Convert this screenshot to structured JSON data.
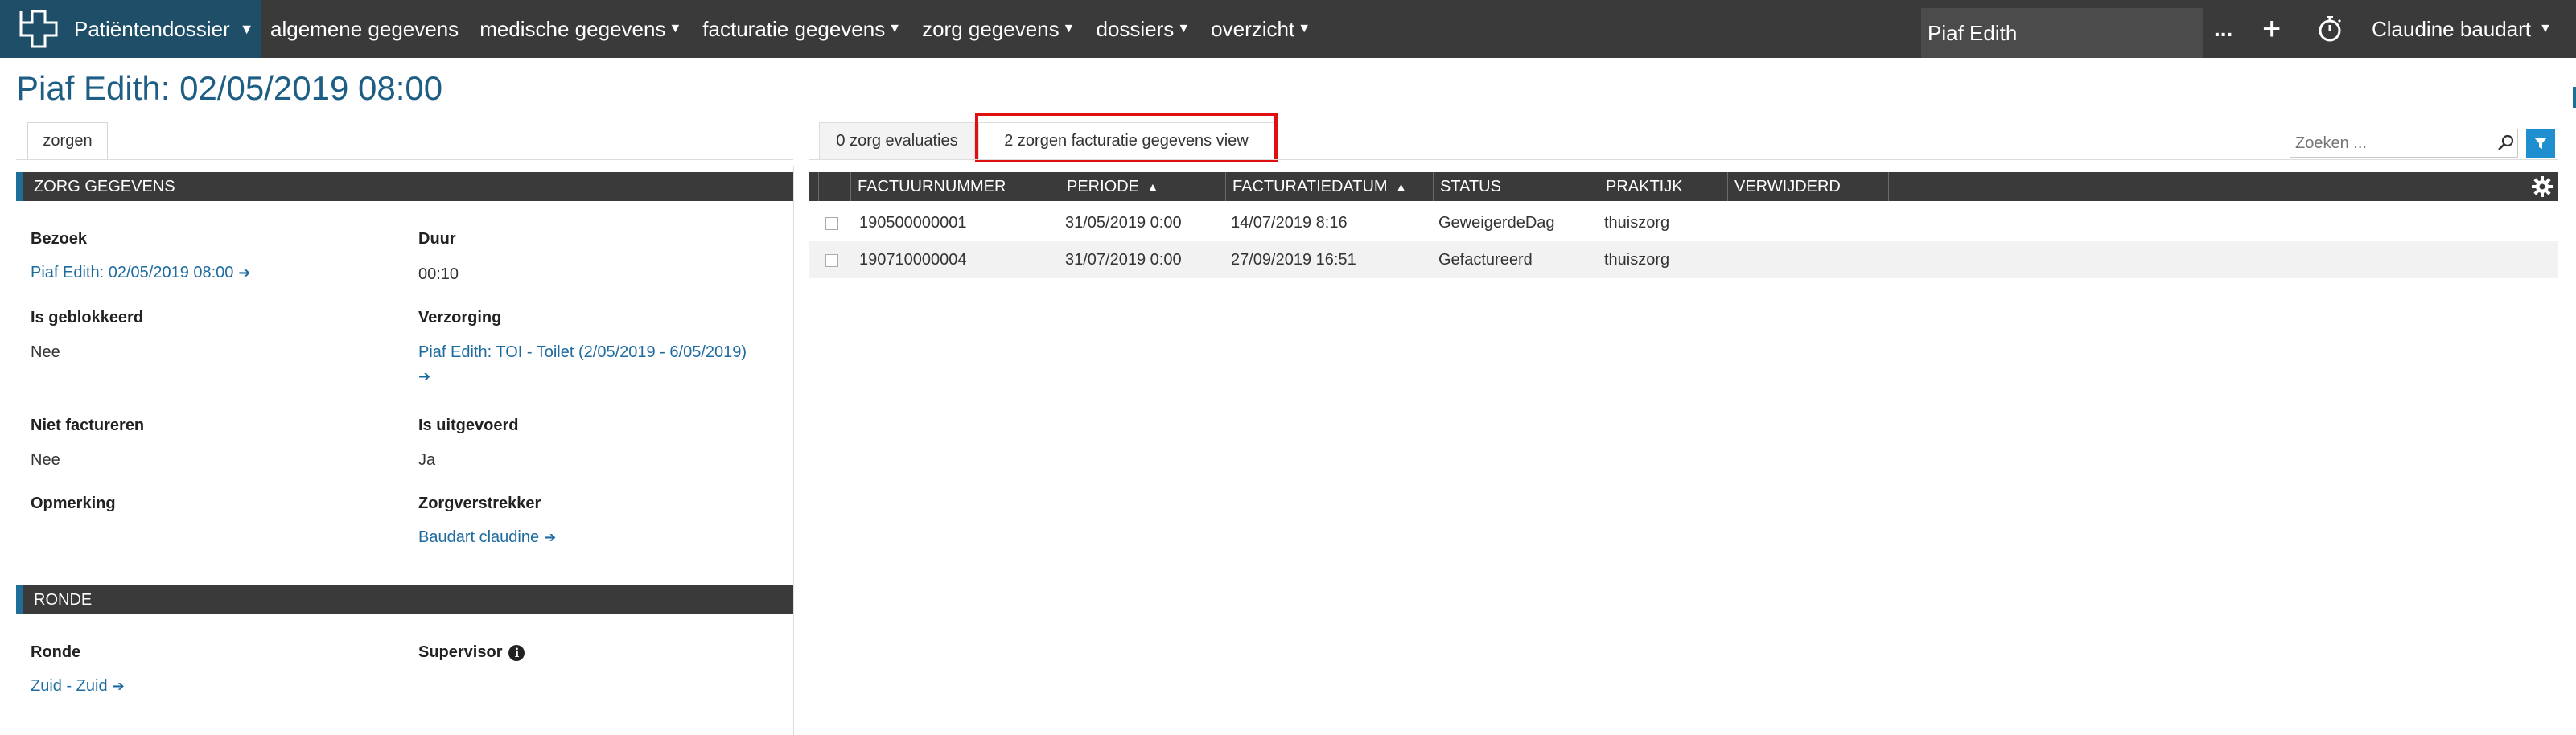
{
  "nav": {
    "brand_label": "Patiëntendossier",
    "menu": [
      {
        "label": "algemene gegevens",
        "dropdown": false
      },
      {
        "label": "medische gegevens",
        "dropdown": true
      },
      {
        "label": "facturatie gegevens",
        "dropdown": true
      },
      {
        "label": "zorg gegevens",
        "dropdown": true
      },
      {
        "label": "dossiers",
        "dropdown": true
      },
      {
        "label": "overzicht",
        "dropdown": true
      }
    ],
    "patient": "Piaf Edith",
    "more": "...",
    "user": "Claudine baudart",
    "icons": [
      "logo-cross-icon",
      "plus-icon",
      "stopwatch-icon"
    ]
  },
  "page_title": "Piaf Edith: 02/05/2019 08:00",
  "left": {
    "tab": "zorgen",
    "zorg_section": {
      "title": "ZORG GEGEVENS",
      "bezoek_label": "Bezoek",
      "bezoek_value": "Piaf Edith: 02/05/2019 08:00",
      "duur_label": "Duur",
      "duur_value": "00:10",
      "geblokkeerd_label": "Is geblokkeerd",
      "geblokkeerd_value": "Nee",
      "verzorging_label": "Verzorging",
      "verzorging_value": "Piaf Edith: TOI - Toilet (2/05/2019 - 6/05/2019)",
      "niet_factureren_label": "Niet factureren",
      "niet_factureren_value": "Nee",
      "uitgevoerd_label": "Is uitgevoerd",
      "uitgevoerd_value": "Ja",
      "opmerking_label": "Opmerking",
      "zorgverstrekker_label": "Zorgverstrekker",
      "zorgverstrekker_value": "Baudart claudine"
    },
    "ronde_section": {
      "title": "RONDE",
      "ronde_label": "Ronde",
      "ronde_value": "Zuid - Zuid",
      "supervisor_label": "Supervisor",
      "info_glyph": "i"
    }
  },
  "right": {
    "tabs": [
      {
        "label": "0 zorg evaluaties",
        "active": false
      },
      {
        "label": "2 zorgen facturatie gegevens view",
        "active": true
      }
    ],
    "search_placeholder": "Zoeken ...",
    "columns": [
      "FACTUURNUMMER",
      "PERIODE",
      "FACTURATIEDATUM",
      "STATUS",
      "PRAKTIJK",
      "VERWIJDERD"
    ],
    "sorted_columns": [
      "PERIODE",
      "FACTURATIEDATUM"
    ],
    "sort_glyph": "▲",
    "rows": [
      {
        "factuurnummer": "190500000001",
        "periode": "31/05/2019 0:00",
        "facturatiedatum": "14/07/2019 8:16",
        "status": "GeweigerdeDag",
        "praktijk": "thuiszorg",
        "verwijderd": ""
      },
      {
        "factuurnummer": "190710000004",
        "periode": "31/07/2019 0:00",
        "facturatiedatum": "27/09/2019 16:51",
        "status": "Gefactureerd",
        "praktijk": "thuiszorg",
        "verwijderd": ""
      }
    ]
  },
  "colors": {
    "nav_bg": "#3a3a3a",
    "brand_bg": "#1f4f68",
    "accent": "#1f6d99",
    "link": "#1e6ba0",
    "highlight": "#e01010",
    "filter_button": "#1f8fd0"
  }
}
